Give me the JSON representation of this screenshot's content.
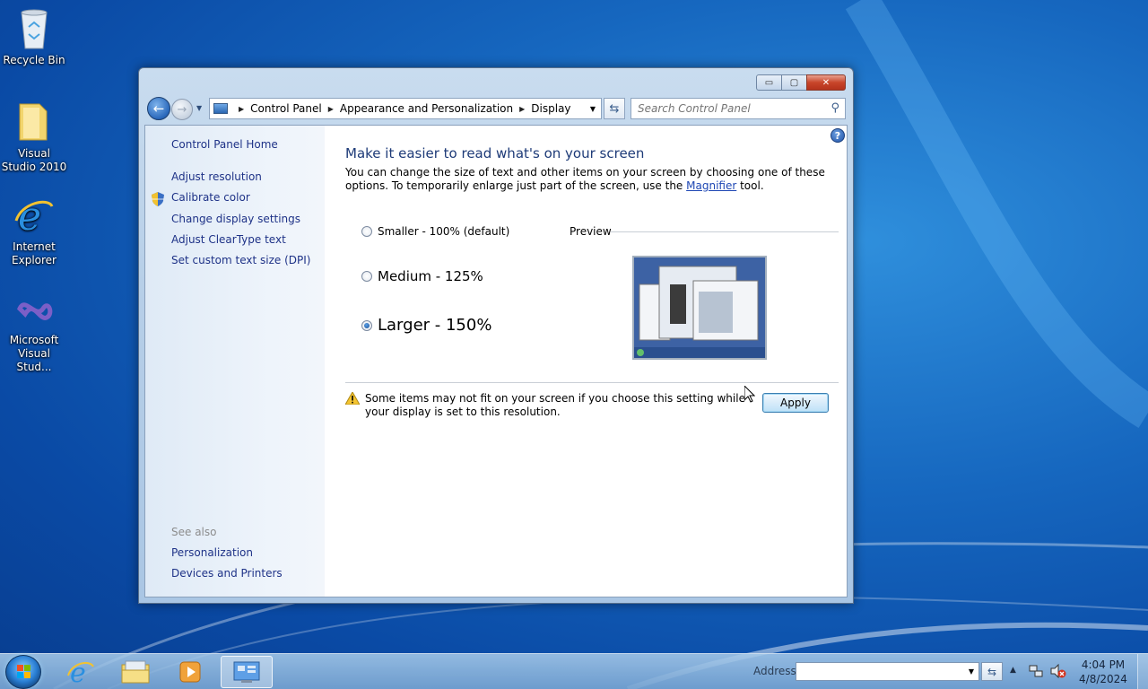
{
  "desktop": {
    "icons": [
      {
        "label": "Recycle Bin",
        "icon": "recycle-bin-icon"
      },
      {
        "label": "Visual Studio 2010",
        "icon": "folder-icon"
      },
      {
        "label": "Internet Explorer",
        "icon": "internet-explorer-icon"
      },
      {
        "label": "Microsoft Visual Stud...",
        "icon": "visual-studio-icon"
      }
    ]
  },
  "window": {
    "controls": {
      "minimize": "▭",
      "maximize": "▢",
      "close": "✕"
    },
    "breadcrumb": [
      "Control Panel",
      "Appearance and Personalization",
      "Display"
    ],
    "search_placeholder": "Search Control Panel"
  },
  "left_pane": {
    "home": "Control Panel Home",
    "links": [
      "Adjust resolution",
      "Calibrate color",
      "Change display settings",
      "Adjust ClearType text",
      "Set custom text size (DPI)"
    ],
    "see_also_heading": "See also",
    "see_also": [
      "Personalization",
      "Devices and Printers"
    ]
  },
  "main": {
    "title": "Make it easier to read what's on your screen",
    "description_before": "You can change the size of text and other items on your screen by choosing one of these options. To temporarily enlarge just part of the screen, use the ",
    "description_link": "Magnifier",
    "description_after": " tool.",
    "options": [
      {
        "label": "Smaller - 100% (default)",
        "checked": false
      },
      {
        "label": "Medium - 125%",
        "checked": false
      },
      {
        "label": "Larger - 150%",
        "checked": true
      }
    ],
    "preview_label": "Preview",
    "warning": "Some items may not fit on your screen if you choose this setting while your display is set to this resolution.",
    "apply_label": "Apply"
  },
  "taskbar": {
    "apps": [
      "internet-explorer-icon",
      "windows-explorer-icon",
      "media-player-icon",
      "control-panel-icon"
    ],
    "address_label": "Address",
    "address_value": "",
    "time": "4:04 PM",
    "date": "4/8/2024"
  },
  "colors": {
    "link": "#1e3287",
    "title": "#1e3b78",
    "accent": "#1667bf"
  }
}
